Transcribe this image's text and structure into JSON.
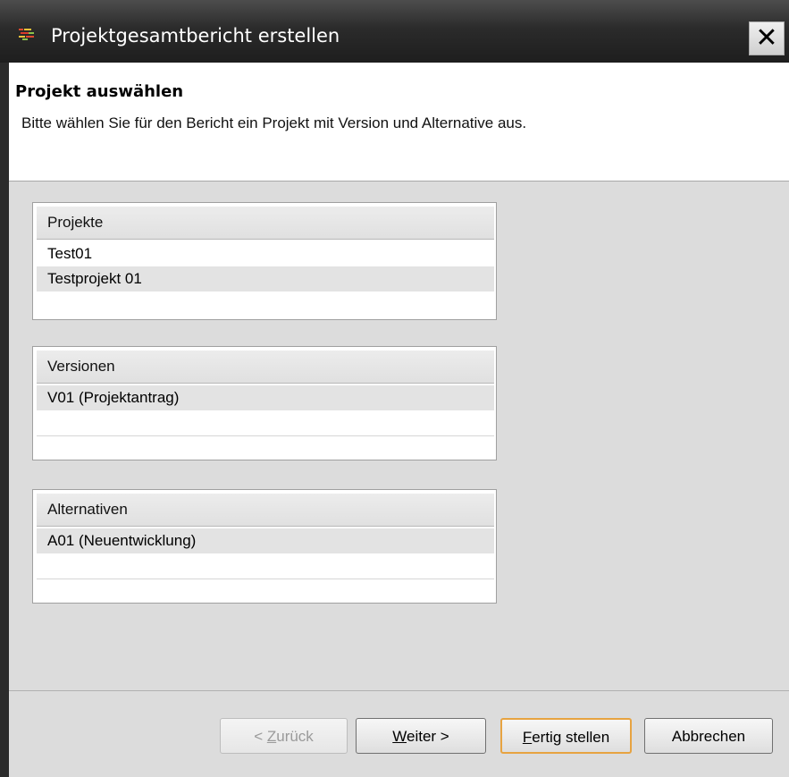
{
  "window": {
    "title": "Projektgesamtbericht erstellen",
    "close_label": "✕"
  },
  "header": {
    "title": "Projekt auswählen",
    "description": "Bitte wählen Sie für den Bericht ein Projekt mit Version und Alternative aus."
  },
  "projects": {
    "header": "Projekte",
    "rows": [
      "Test01",
      "Testprojekt 01"
    ]
  },
  "versions": {
    "header": "Versionen",
    "rows": [
      "V01 (Projektantrag)"
    ]
  },
  "alternatives": {
    "header": "Alternativen",
    "rows": [
      "A01 (Neuentwicklung)"
    ]
  },
  "buttons": {
    "back": {
      "prefix": "< ",
      "mnemonic": "Z",
      "rest": "urück",
      "enabled": false
    },
    "next": {
      "mnemonic": "W",
      "rest": "eiter >"
    },
    "finish": {
      "mnemonic": "F",
      "rest": "ertig stellen"
    },
    "cancel": "Abbrechen"
  },
  "colors": {
    "titlebar": "#2b2b2b",
    "default_button_border": "#e7a341"
  }
}
